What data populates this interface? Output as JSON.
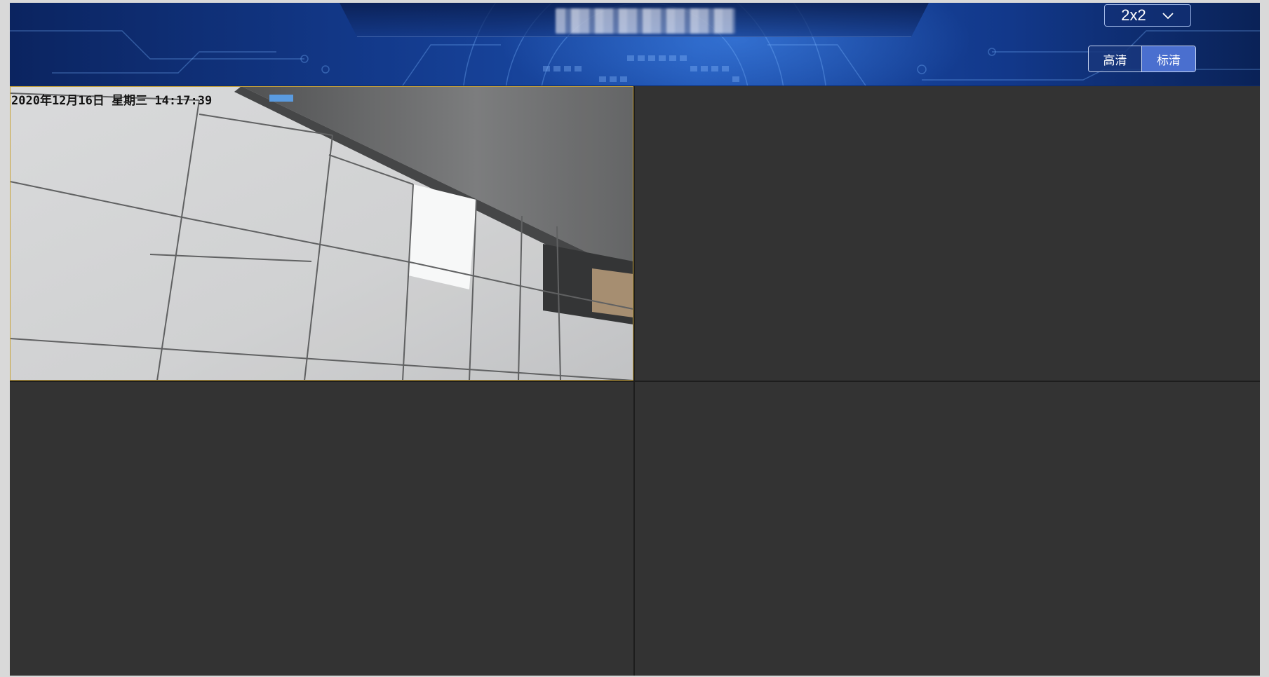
{
  "header": {
    "title": "",
    "title_obscured": true
  },
  "controls": {
    "layout_select": {
      "value": "2x2",
      "icon": "chevron-down-icon"
    },
    "quality": {
      "hd_label": "高清",
      "sd_label": "标清",
      "selected": "标清"
    }
  },
  "video_grid": {
    "layout": "2x2",
    "cells": [
      {
        "id": 1,
        "active": true,
        "has_video": true,
        "osd_timestamp": "2020年12月16日  星期三  14:17:39"
      },
      {
        "id": 2,
        "active": false,
        "has_video": false
      },
      {
        "id": 3,
        "active": false,
        "has_video": false
      },
      {
        "id": 4,
        "active": false,
        "has_video": false
      }
    ]
  },
  "colors": {
    "header_base": "#133a8c",
    "empty_cell": "#333333",
    "active_border": "#c9a43a",
    "selected_button": "#4a6fcf"
  }
}
